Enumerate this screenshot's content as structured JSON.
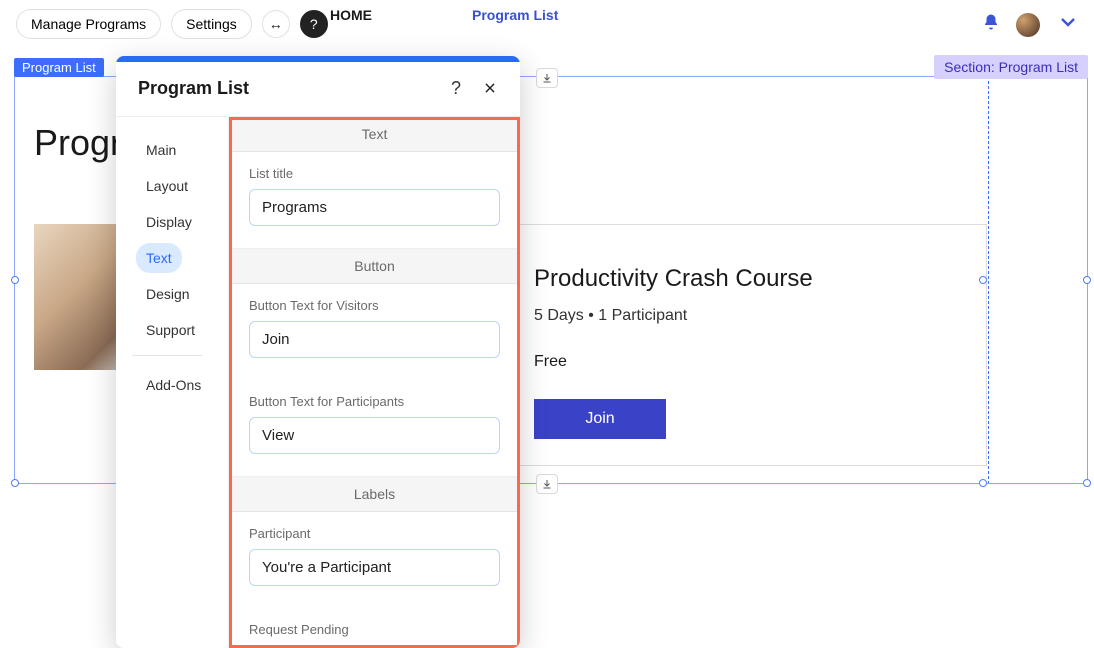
{
  "topbar": {
    "manage_label": "Manage Programs",
    "settings_label": "Settings"
  },
  "nav": {
    "home": "HOME",
    "program_list": "Program List"
  },
  "section": {
    "right_label": "Section: Program List",
    "left_label": "Program List"
  },
  "page": {
    "title_partial": "Progra"
  },
  "card": {
    "title": "Productivity Crash Course",
    "meta": "5 Days • 1 Participant",
    "price": "Free",
    "button": "Join"
  },
  "panel": {
    "title": "Program List",
    "nav": {
      "main": "Main",
      "layout": "Layout",
      "display": "Display",
      "text": "Text",
      "design": "Design",
      "support": "Support",
      "addons": "Add-Ons"
    },
    "groups": {
      "text": "Text",
      "button": "Button",
      "labels": "Labels"
    },
    "fields": {
      "list_title_label": "List title",
      "list_title_value": "Programs",
      "btn_visitors_label": "Button Text for Visitors",
      "btn_visitors_value": "Join",
      "btn_participants_label": "Button Text for Participants",
      "btn_participants_value": "View",
      "participant_label": "Participant",
      "participant_value": "You're a Participant",
      "request_pending_label": "Request Pending"
    }
  }
}
